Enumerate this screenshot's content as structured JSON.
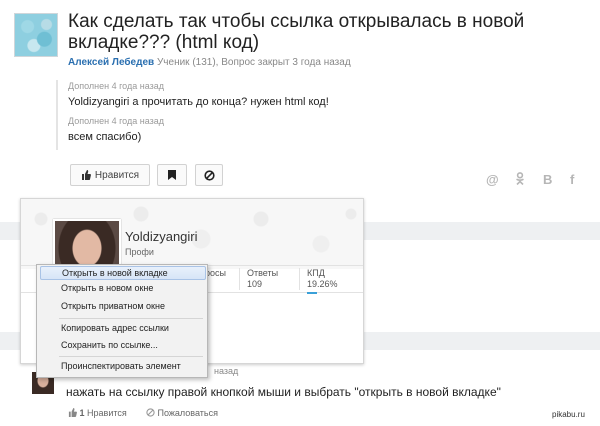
{
  "question": {
    "title": "Как сделать так чтобы ссылка открывалась в новой вкладке??? (html код)",
    "author": "Алексей Лебедев",
    "author_meta": "Ученик (131), Вопрос закрыт 3 года назад",
    "additions": [
      {
        "meta": "Дополнен 4 года назад",
        "text": "Yoldizyangiri а прочитать до конца? нужен html код!"
      },
      {
        "meta": "Дополнен 4 года назад",
        "text": "всем спасибо)"
      }
    ],
    "like_label": "Нравится"
  },
  "share_icons": [
    "@",
    "ok",
    "B",
    "f"
  ],
  "profile_card": {
    "name": "Yoldizyangiri",
    "rank": "Профи",
    "stats": [
      {
        "label": "росы",
        "value": ""
      },
      {
        "label": "Ответы",
        "value": "109"
      },
      {
        "label": "КПД",
        "value": "19.26%"
      }
    ],
    "kpd_fill": 0.1926
  },
  "context_menu": {
    "items": [
      "Открыть в новой вкладке",
      "Открыть в новом окне",
      "Открыть приватном окне",
      "Копировать адрес ссылки",
      "Сохранить по ссылке...",
      "Проинспектировать элемент"
    ],
    "highlighted_index": 0
  },
  "answer": {
    "meta": "назад",
    "text": "нажать на ссылку правой кнопкой мыши и выбрать \"открыть в новой вкладке\"",
    "like_count": "1",
    "like_label": "Нравится",
    "report_label": "Пожаловаться",
    "link_fragment": "о"
  },
  "watermark": "pikabu.ru"
}
